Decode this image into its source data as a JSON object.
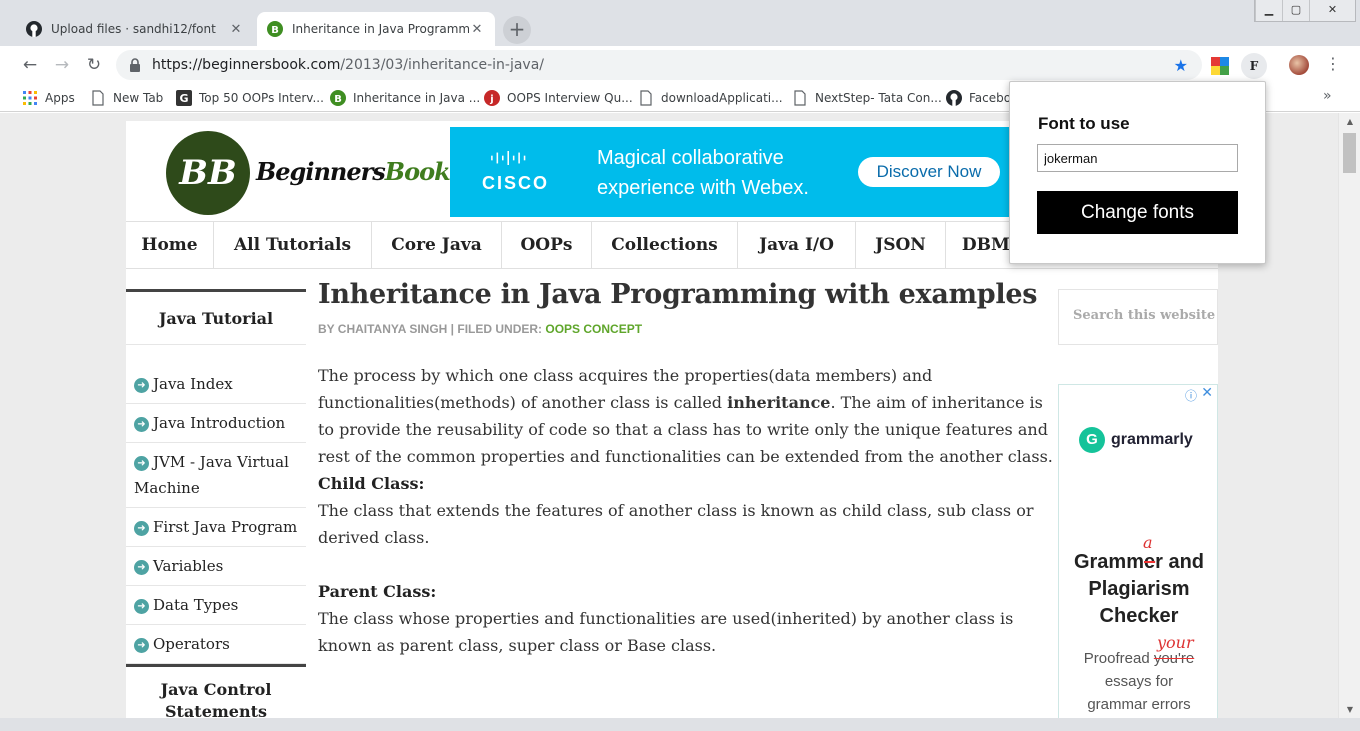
{
  "browser": {
    "tabs": [
      {
        "title": "Upload files · sandhi12/font",
        "icon": "github-icon",
        "active": false
      },
      {
        "title": "Inheritance in Java Programming",
        "icon": "beginnersbook-icon",
        "active": true
      }
    ],
    "url_host": "https://beginnersbook.com",
    "url_path": "/2013/03/inheritance-in-java/",
    "extension_letter": "F",
    "bookmarks": [
      {
        "label": "Apps",
        "icon": "apps-grid-icon"
      },
      {
        "label": "New Tab",
        "icon": "page-icon"
      },
      {
        "label": "Top 50 OOPs Interv...",
        "icon": "guru99-icon"
      },
      {
        "label": "Inheritance in Java ...",
        "icon": "beginnersbook-icon"
      },
      {
        "label": "OOPS Interview Qu...",
        "icon": "javatpoint-icon"
      },
      {
        "label": "downloadApplicati...",
        "icon": "page-icon"
      },
      {
        "label": "NextStep- Tata Con...",
        "icon": "page-icon"
      },
      {
        "label": "Facebo",
        "icon": "github-icon"
      }
    ],
    "bookmarks_more": "»"
  },
  "site": {
    "logo_mark": "BB",
    "logo_text_a": "Beginners",
    "logo_text_b": "Book",
    "ad_banner": {
      "brand": "CISCO",
      "line1": "Magical collaborative",
      "line2": "experience with Webex.",
      "button": "Discover Now"
    },
    "nav": [
      "Home",
      "All Tutorials",
      "Core Java",
      "OOPs",
      "Collections",
      "Java I/O",
      "JSON",
      "DBMS"
    ],
    "left_sidebar": {
      "heading": "Java Tutorial",
      "items": [
        "Java Index",
        "Java Introduction",
        "JVM - Java Virtual Machine",
        "First Java Program",
        "Variables",
        "Data Types",
        "Operators"
      ],
      "heading2": "Java Control Statements"
    },
    "article": {
      "title": "Inheritance in Java Programming with examples",
      "byline_prefix": "BY CHAITANYA SINGH | FILED UNDER: ",
      "byline_category": "OOPS CONCEPT",
      "p1_a": "The process by which one class acquires the properties(data members) and functionalities(methods) of another class is called ",
      "p1_bold": "inheritance",
      "p1_b": ". The aim of inheritance is to provide the reusability of code so that a class has to write only the unique features and rest of the common properties and functionalities can be extended from the another class.",
      "child_heading": "Child Class:",
      "child_text": "The class that extends the features of another class is known as child class, sub class or derived class.",
      "parent_heading": "Parent Class:",
      "parent_text": "The class whose properties and functionalities are used(inherited) by another class is known as parent class, super class or Base class."
    },
    "search_placeholder": "Search this website",
    "side_ad": {
      "brand": "grammarly",
      "brand_letter": "G",
      "head1_pre": "Gramm",
      "head1_strike": "e",
      "head1_post": "r and",
      "head_fix": "a",
      "head2": "Plagiarism",
      "head3": "Checker",
      "sub1_pre": "Proofread ",
      "sub1_strike": "you're",
      "sub_fix": "your",
      "sub2": "essays for",
      "sub3": "grammar errors",
      "info": "ⓘ",
      "close": "✕"
    }
  },
  "popup": {
    "label": "Font to use",
    "input_value": "jokerman",
    "button": "Change fonts"
  },
  "colors": {
    "banner": "#00bceb",
    "category": "#5fa62b",
    "popup_button": "#000000",
    "grammarly": "#15c39a"
  }
}
